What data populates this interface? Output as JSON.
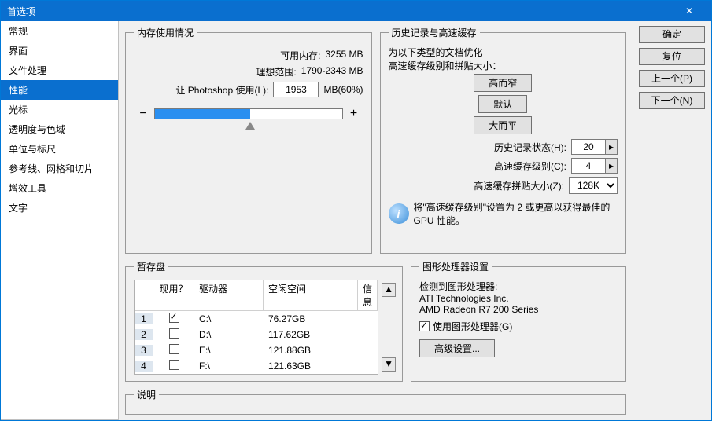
{
  "window": {
    "title": "首选项",
    "close": "✕"
  },
  "sidebar": {
    "items": [
      "常规",
      "界面",
      "文件处理",
      "性能",
      "光标",
      "透明度与色域",
      "单位与标尺",
      "参考线、网格和切片",
      "增效工具",
      "文字"
    ],
    "selected_index": 3
  },
  "buttons": {
    "ok": "确定",
    "reset": "复位",
    "prev": "上一个(P)",
    "next": "下一个(N)"
  },
  "memory": {
    "legend": "内存使用情况",
    "available_label": "可用内存:",
    "available_value": "3255 MB",
    "ideal_label": "理想范围:",
    "ideal_value": "1790-2343 MB",
    "let_label": "让 Photoshop 使用(L):",
    "let_value": "1953",
    "let_unit": "MB(60%)",
    "minus": "−",
    "plus": "+"
  },
  "cache": {
    "legend": "历史记录与高速缓存",
    "opt_text": "为以下类型的文档优化\n高速缓存级别和拼贴大小：",
    "btn_tall": "高而窄",
    "btn_default": "默认",
    "btn_wide": "大而平",
    "history_label": "历史记录状态(H):",
    "history_value": "20",
    "levels_label": "高速缓存级别(C):",
    "levels_value": "4",
    "tile_label": "高速缓存拼贴大小(Z):",
    "tile_value": "128K",
    "tile_options": [
      "128K"
    ],
    "info": "将\"高速缓存级别\"设置为 2 或更高以获得最佳的 GPU 性能。",
    "info_icon": "i",
    "spin_arrow": "▸"
  },
  "scratch": {
    "legend": "暂存盘",
    "headers": {
      "use": "现用？",
      "drive": "驱动器",
      "space": "空闲空间",
      "info": "信息"
    },
    "rows": [
      {
        "idx": "1",
        "use": true,
        "drive": "C:\\",
        "space": "76.27GB"
      },
      {
        "idx": "2",
        "use": false,
        "drive": "D:\\",
        "space": "117.62GB"
      },
      {
        "idx": "3",
        "use": false,
        "drive": "E:\\",
        "space": "121.88GB"
      },
      {
        "idx": "4",
        "use": false,
        "drive": "F:\\",
        "space": "121.63GB"
      }
    ],
    "up": "▲",
    "down": "▼"
  },
  "gpu": {
    "legend": "图形处理器设置",
    "detect_label": "检测到图形处理器:",
    "vendor": "ATI Technologies Inc.",
    "model": "AMD Radeon R7 200 Series",
    "use_gpu_label": "使用图形处理器(G)",
    "use_gpu": true,
    "advanced": "高级设置..."
  },
  "desc": {
    "legend": "说明"
  }
}
